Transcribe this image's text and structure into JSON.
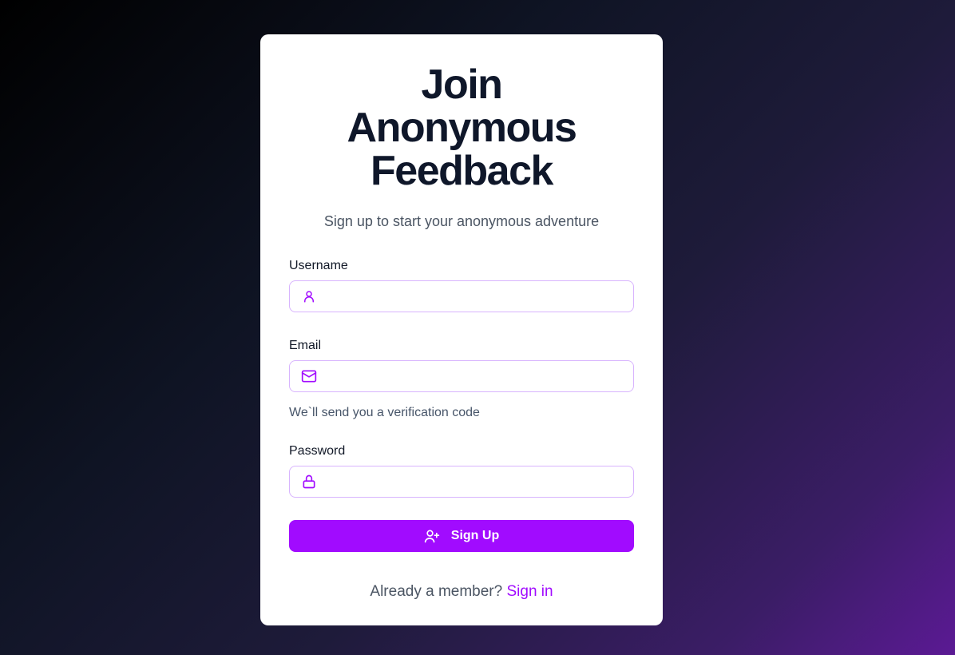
{
  "colors": {
    "accent": "#a10bff",
    "input_border": "#d8b4fe",
    "heading": "#0f172a",
    "muted_text": "#4b5563"
  },
  "header": {
    "title": "Join Anonymous Feedback",
    "subtitle": "Sign up to start your anonymous adventure"
  },
  "form": {
    "username": {
      "label": "Username",
      "value": "",
      "placeholder": "",
      "icon": "user-icon"
    },
    "email": {
      "label": "Email",
      "value": "",
      "placeholder": "",
      "icon": "mail-icon",
      "helper": "We`ll send you a verification code"
    },
    "password": {
      "label": "Password",
      "value": "",
      "placeholder": "",
      "icon": "lock-icon"
    },
    "submit": {
      "label": "Sign Up",
      "icon": "user-plus-icon"
    }
  },
  "footer": {
    "prompt": "Already a member?",
    "link_label": "Sign in"
  }
}
